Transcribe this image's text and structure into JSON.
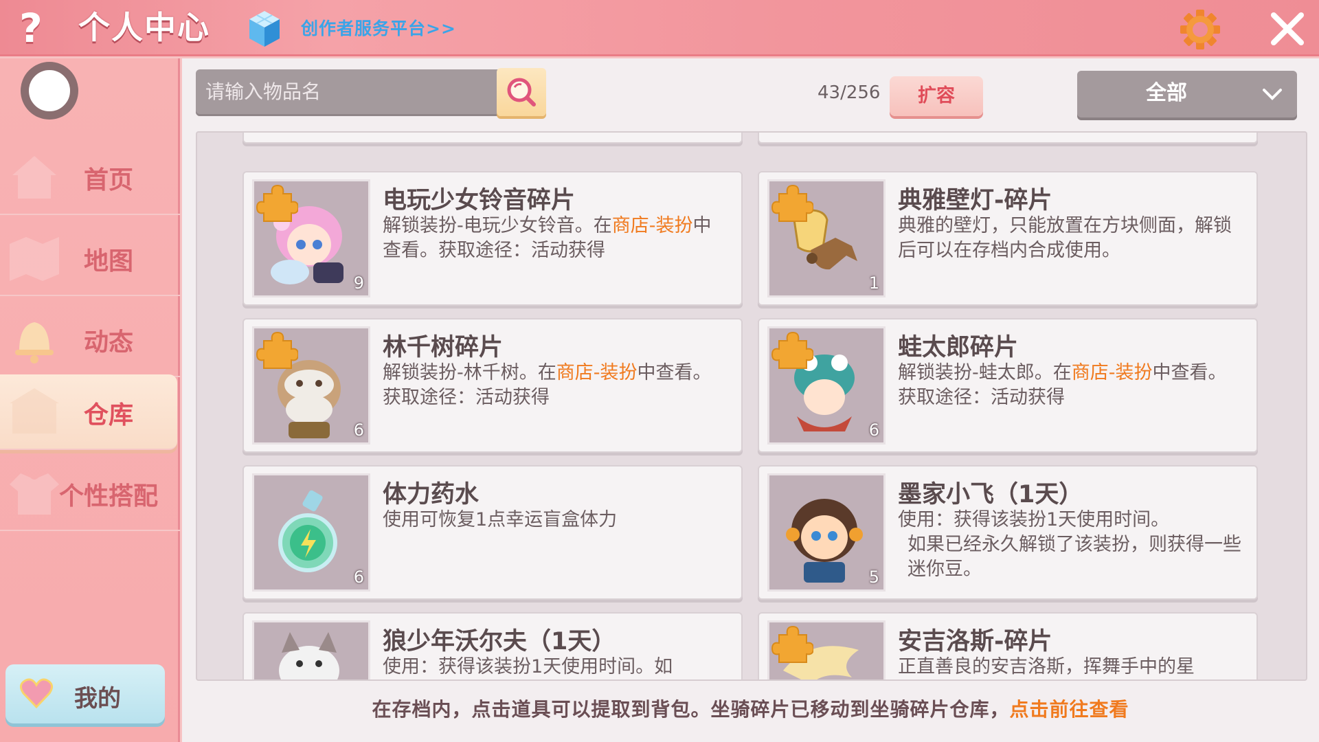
{
  "header": {
    "help_icon": "?",
    "title": "个人中心",
    "creator_link": "创作者服务平台>>"
  },
  "sidebar": {
    "items": [
      {
        "label": "首页",
        "icon": "house-icon"
      },
      {
        "label": "地图",
        "icon": "map-icon"
      },
      {
        "label": "动态",
        "icon": "bell-icon"
      },
      {
        "label": "仓库",
        "icon": "warehouse-icon",
        "active": true
      },
      {
        "label": "个性搭配",
        "icon": "outfit-icon"
      }
    ],
    "mine_label": "我的"
  },
  "toolbar": {
    "search_placeholder": "请输入物品名",
    "capacity": "43/256",
    "expand_label": "扩容",
    "filter_value": "全部"
  },
  "items": [
    {
      "title": "电玩少女铃音碎片",
      "desc_parts": [
        "解锁装扮-电玩少女铃音。在",
        "商店-装扮",
        "中查看。获取途径：活动获得"
      ],
      "count": "9",
      "fragment": true
    },
    {
      "title": "典雅壁灯-碎片",
      "desc_parts": [
        "典雅的壁灯，只能放置在方块侧面，解锁后可以在存档内合成使用。"
      ],
      "count": "1",
      "fragment": true
    },
    {
      "title": "林千树碎片",
      "desc_parts": [
        "解锁装扮-林千树。在",
        "商店-装扮",
        "中查看。获取途径：活动获得"
      ],
      "count": "6",
      "fragment": true
    },
    {
      "title": "蛙太郎碎片",
      "desc_parts": [
        "解锁装扮-蛙太郎。在",
        "商店-装扮",
        "中查看。获取途径：活动获得"
      ],
      "count": "6",
      "fragment": true
    },
    {
      "title": "体力药水",
      "desc_parts": [
        "使用可恢复1点幸运盲盒体力"
      ],
      "count": "6",
      "fragment": false
    },
    {
      "title": "墨家小飞（1天）",
      "desc_parts": [
        "使用：获得该装扮1天使用时间。",
        "如果已经永久解锁了该装扮，则获得一些迷你豆。"
      ],
      "count": "5",
      "fragment": false
    },
    {
      "title": "狼少年沃尔夫（1天）",
      "desc_parts": [
        "使用：获得该装扮1天使用时间。如"
      ],
      "count": "",
      "fragment": false
    },
    {
      "title": "安吉洛斯-碎片",
      "desc_parts": [
        "正直善良的安吉洛斯，挥舞手中的星"
      ],
      "count": "",
      "fragment": true
    }
  ],
  "footer": {
    "tip": "在存档内，点击道具可以提取到背包。坐骑碎片已移动到坐骑碎片仓库，",
    "link": "点击前往查看"
  },
  "colors": {
    "header_bg": "#ef8d95",
    "sidebar_bg": "#f8b2b3",
    "accent_orange": "#f07a1e",
    "link_blue": "#3aa4e8"
  }
}
